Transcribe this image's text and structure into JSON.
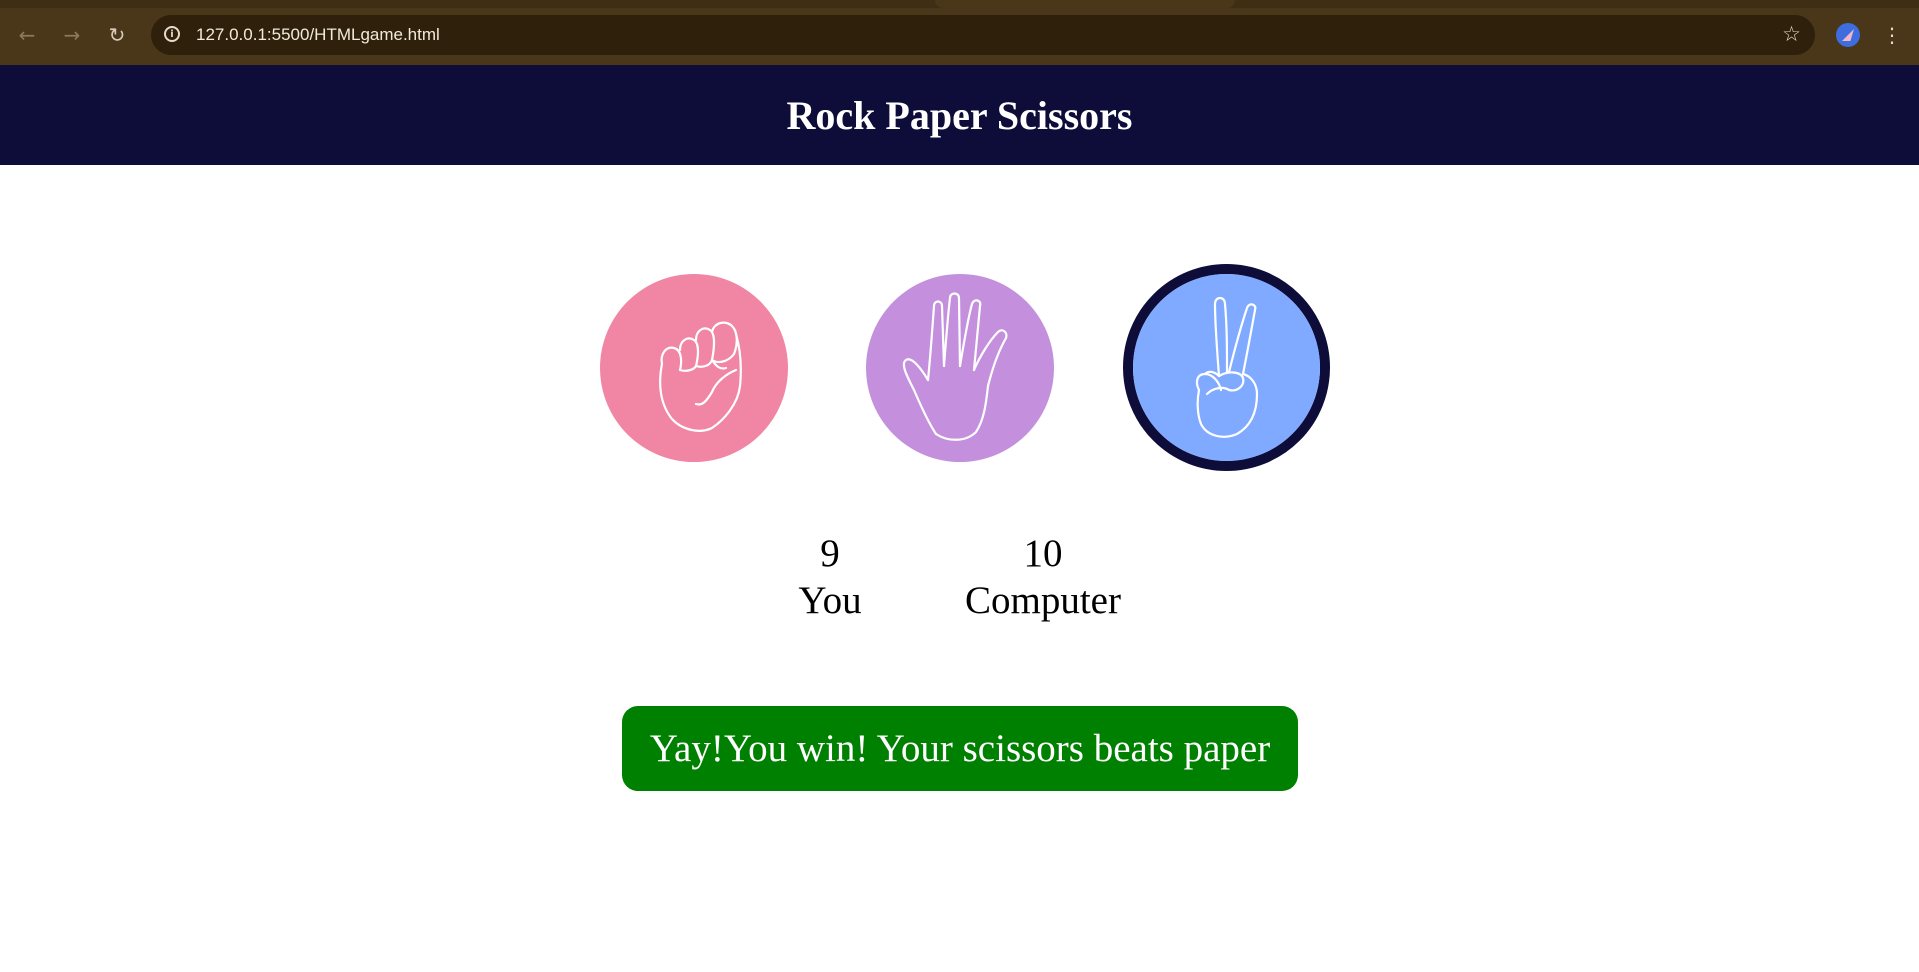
{
  "browser": {
    "url": "127.0.0.1:5500/HTMLgame.html",
    "icons": [
      "back-arrow-icon",
      "forward-arrow-icon",
      "reload-icon",
      "info-icon",
      "star-icon",
      "profile-icon",
      "menu-dots-icon"
    ]
  },
  "game": {
    "title": "Rock Paper Scissors",
    "choices": [
      {
        "id": "rock",
        "icon": "fist-icon",
        "color": "#f086a4"
      },
      {
        "id": "paper",
        "icon": "open-hand-icon",
        "color": "#c490dd"
      },
      {
        "id": "scissors",
        "icon": "victory-hand-icon",
        "color": "#80aaff",
        "selected": true
      }
    ],
    "score": {
      "user_value": "9",
      "user_label": "You",
      "comp_value": "10",
      "comp_label": "Computer"
    },
    "message": "Yay!You win! Your scissors beats paper",
    "message_color": "#008000",
    "header_color": "#0e0c39"
  }
}
